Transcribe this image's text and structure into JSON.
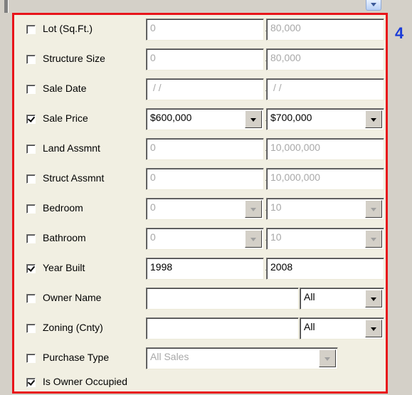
{
  "section_number": "4",
  "rows": [
    {
      "label": "Lot (Sq.Ft.)",
      "checked": false,
      "from": "0",
      "to": "80,000"
    },
    {
      "label": "Structure Size",
      "checked": false,
      "from": "0",
      "to": "80,000"
    },
    {
      "label": "Sale Date",
      "checked": false,
      "from": "/ /",
      "to": "/ /"
    },
    {
      "label": "Sale Price",
      "checked": true,
      "from": "$600,000",
      "to": "$700,000"
    },
    {
      "label": "Land Assmnt",
      "checked": false,
      "from": "0",
      "to": "10,000,000"
    },
    {
      "label": "Struct Assmnt",
      "checked": false,
      "from": "0",
      "to": "10,000,000"
    },
    {
      "label": "Bedroom",
      "checked": false,
      "from": "0",
      "to": "10"
    },
    {
      "label": "Bathroom",
      "checked": false,
      "from": "0",
      "to": "10"
    },
    {
      "label": "Year Built",
      "checked": true,
      "from": "1998",
      "to": "2008"
    },
    {
      "label": "Owner Name",
      "checked": false,
      "value": "",
      "select": "All"
    },
    {
      "label": "Zoning (Cnty)",
      "checked": false,
      "value": "",
      "select": "All"
    },
    {
      "label": "Purchase Type",
      "checked": false,
      "select": "All Sales"
    },
    {
      "label": "Is Owner Occupied",
      "checked": true
    }
  ],
  "separator": "-"
}
